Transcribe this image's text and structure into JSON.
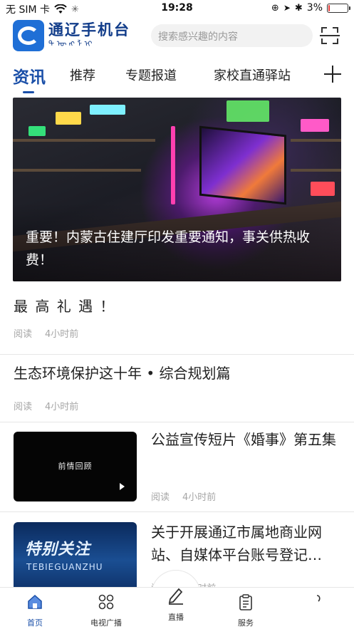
{
  "status_bar": {
    "carrier": "无 SIM 卡",
    "time": "19:28",
    "battery": "3%",
    "battery_level": 0.03,
    "battery_color": "#e53935"
  },
  "header": {
    "app_name": "通辽手机台",
    "app_name_mongolian": "ᠲᠦᠩᠯᠢᠶᠣ",
    "search_placeholder": "搜索感兴趣的内容",
    "logo_icon": "tongliao-logo",
    "scan_icon": "scan-icon"
  },
  "tabs": [
    {
      "label": "资讯",
      "active": true
    },
    {
      "label": "推荐",
      "active": false
    },
    {
      "label": "专题报道",
      "active": false
    },
    {
      "label": "家校直通驿站",
      "active": false
    }
  ],
  "accent_color": "#1a4fa8",
  "banner": {
    "caption": "重要！内蒙古住建厅印发重要通知，事关供热收费！"
  },
  "articles": [
    {
      "title": "最 高 礼 遇 ！",
      "meta_read": "阅读",
      "meta_time": "4小时前"
    },
    {
      "title": "生态环境保护这十年 • 综合规划篇",
      "meta_read": "阅读",
      "meta_time": "4小时前"
    },
    {
      "title": "公益宣传短片《婚事》第五集",
      "meta_read": "阅读",
      "meta_time": "4小时前",
      "thumb_text": "前情回顾"
    },
    {
      "title": "关于开展通辽市属地商业网站、自媒体平台账号登记…",
      "meta_read": "阅读",
      "meta_time": "4小时前",
      "thumb_text": "特别关注",
      "thumb_sub": "TEBIEGUANZHU"
    }
  ],
  "bottom_nav": [
    {
      "label": "首页",
      "icon": "home-icon",
      "active": true
    },
    {
      "label": "电视广播",
      "icon": "grid-icon",
      "active": false
    },
    {
      "label": "直播",
      "icon": "pen-icon",
      "active": false
    },
    {
      "label": "服务",
      "icon": "clipboard-icon",
      "active": false
    },
    {
      "label": "",
      "icon": "user-icon",
      "active": false
    }
  ]
}
